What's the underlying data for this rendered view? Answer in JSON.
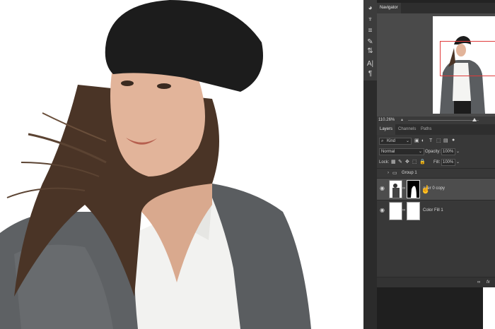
{
  "tools": {
    "icons": [
      "color-wheel-icon",
      "adjust-brush-icon",
      "sliders-icon",
      "paint-brush-icon",
      "arrange-icon",
      "text-icon",
      "paragraph-icon"
    ],
    "text_icon_glyph": "A|",
    "paragraph_icon_glyph": "¶"
  },
  "navigator": {
    "tab_label": "Navigator",
    "zoom": "110.26%",
    "view_box_color": "#e03a3a"
  },
  "layers_panel": {
    "tabs": [
      "Layers",
      "Channels",
      "Paths"
    ],
    "filter_kind": "Kind",
    "blend_mode": "Normal",
    "opacity_label": "Opacity:",
    "opacity_value": "100%",
    "lock_label": "Lock:",
    "fill_label": "Fill:",
    "fill_value": "100%",
    "layers": [
      {
        "name": "Group 1",
        "type": "group"
      },
      {
        "name": "ayer 0 copy",
        "type": "image",
        "selected": true
      },
      {
        "name": "Color Fill 1",
        "type": "fill"
      }
    ],
    "footer_icons": [
      "link-icon",
      "fx-icon"
    ],
    "footer_fx": "fx"
  }
}
